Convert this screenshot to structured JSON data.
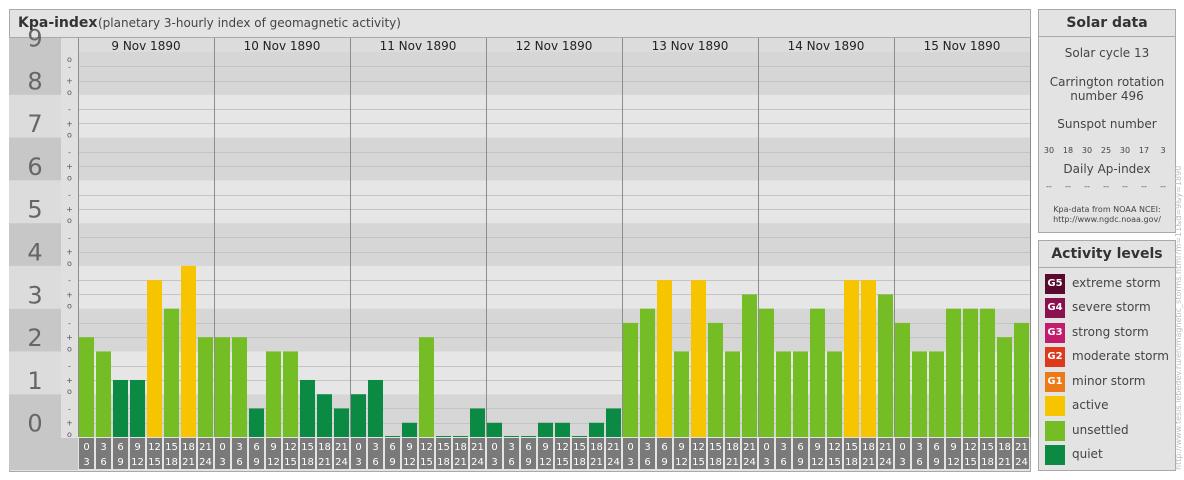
{
  "header": {
    "title": "Kpa-index",
    "subtitle": "(planetary 3-hourly index of geomagnetic activity)"
  },
  "chart_data": {
    "type": "bar",
    "ylim": [
      0,
      9
    ],
    "y_ticks": [
      "0",
      "1",
      "2",
      "3",
      "4",
      "5",
      "6",
      "7",
      "8",
      "9"
    ],
    "y_minor_marks": [
      "o",
      "+",
      "-"
    ],
    "days": [
      "9 Nov 1890",
      "10 Nov 1890",
      "11 Nov 1890",
      "12 Nov 1890",
      "13 Nov 1890",
      "14 Nov 1890",
      "15 Nov 1890"
    ],
    "hour_labels": [
      [
        "0",
        "3"
      ],
      [
        "3",
        "6"
      ],
      [
        "6",
        "9"
      ],
      [
        "9",
        "12"
      ],
      [
        "12",
        "15"
      ],
      [
        "15",
        "18"
      ],
      [
        "18",
        "21"
      ],
      [
        "21",
        "24"
      ]
    ],
    "values": [
      [
        2.333,
        2.0,
        1.333,
        1.333,
        3.667,
        3.0,
        4.0,
        2.333
      ],
      [
        2.333,
        2.333,
        0.667,
        2.0,
        2.0,
        1.333,
        1.0,
        0.667
      ],
      [
        1.0,
        1.333,
        0.0,
        0.333,
        2.333,
        0.0,
        0.0,
        0.667
      ],
      [
        0.333,
        0.0,
        0.0,
        0.333,
        0.333,
        0.0,
        0.333,
        0.667
      ],
      [
        2.667,
        3.0,
        3.667,
        2.0,
        3.667,
        2.667,
        2.0,
        3.333
      ],
      [
        3.0,
        2.0,
        2.0,
        3.0,
        2.0,
        3.667,
        3.667,
        3.333
      ],
      [
        2.667,
        2.0,
        2.0,
        3.0,
        3.0,
        3.0,
        2.333,
        2.667
      ]
    ],
    "colors": {
      "quiet": "#0b8a44",
      "unsettled": "#74bd24",
      "active": "#f6c500"
    }
  },
  "solar_data": {
    "title": "Solar data",
    "cycle": "Solar cycle 13",
    "carrington_line1": "Carrington rotation",
    "carrington_line2": "number 496",
    "sunspot_label": "Sunspot number",
    "sunspots": [
      "30",
      "18",
      "30",
      "25",
      "30",
      "17",
      "3"
    ],
    "ap_label": "Daily Ap-index",
    "ap_values": [
      "--",
      "--",
      "--",
      "--",
      "--",
      "--",
      "--"
    ],
    "source_line1": "Kpa-data from NOAA NCEI:",
    "source_line2": "http://www.ngdc.noaa.gov/"
  },
  "activity_levels": {
    "title": "Activity levels",
    "items": [
      {
        "code": "G5",
        "label": "extreme storm",
        "color": "#5a0a2e"
      },
      {
        "code": "G4",
        "label": "severe storm",
        "color": "#8a1050"
      },
      {
        "code": "G3",
        "label": "strong storm",
        "color": "#c21c6c"
      },
      {
        "code": "G2",
        "label": "moderate storm",
        "color": "#dd3a1d"
      },
      {
        "code": "G1",
        "label": "minor storm",
        "color": "#ec7a18"
      },
      {
        "code": "",
        "label": "active",
        "color": "#f6c500"
      },
      {
        "code": "",
        "label": "unsettled",
        "color": "#74bd24"
      },
      {
        "code": "",
        "label": "quiet",
        "color": "#0b8a44"
      }
    ]
  },
  "watermark": "http://www.tesis.lebedev.ru/en/magnetic_storms.html?m=11&d=9&y=1890"
}
